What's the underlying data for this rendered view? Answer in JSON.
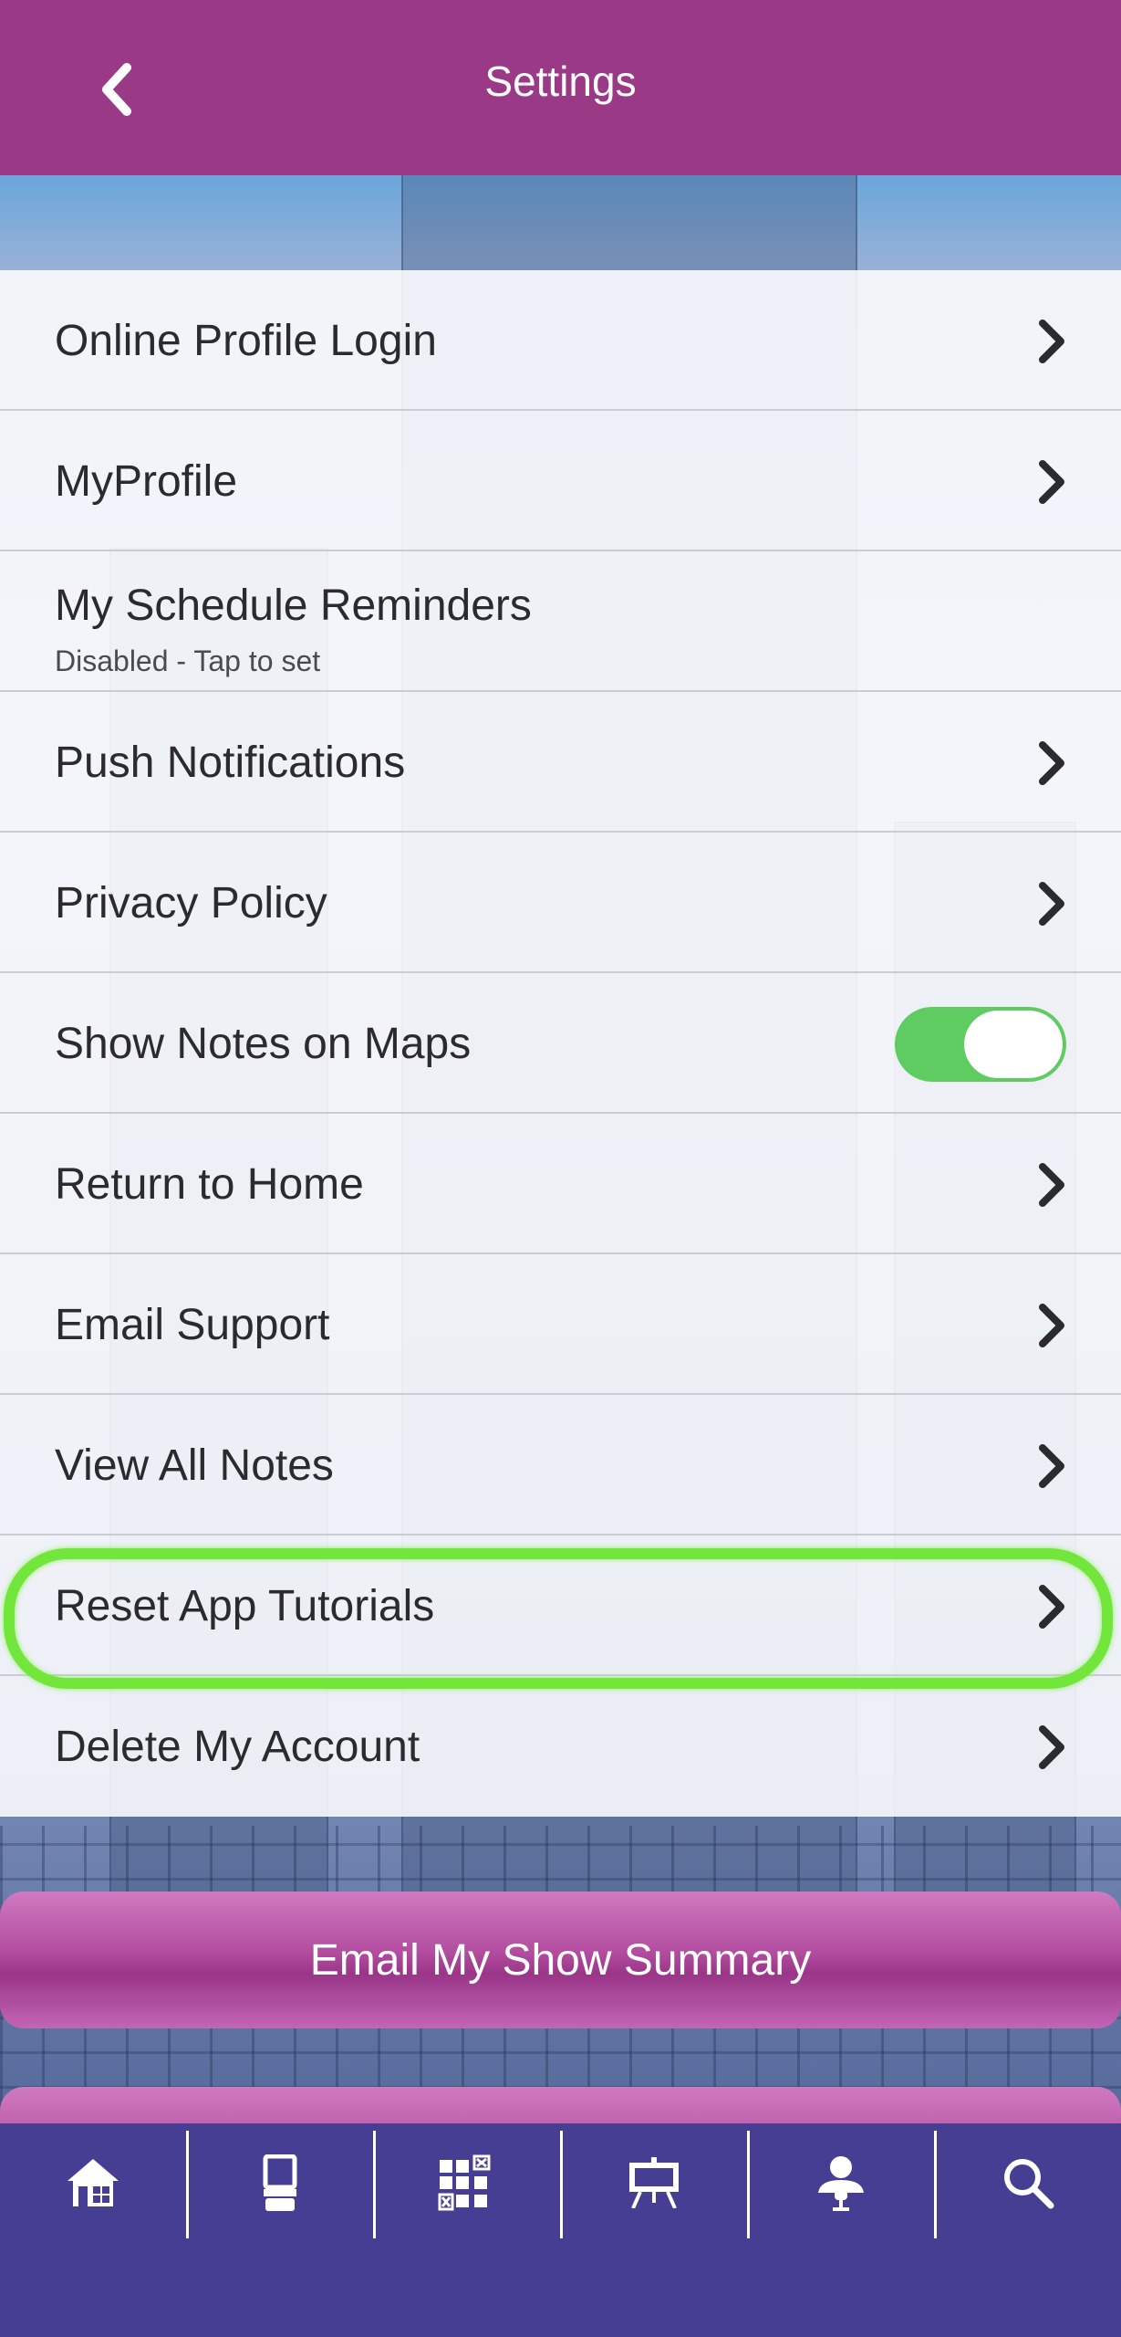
{
  "header": {
    "title": "Settings",
    "back_icon": "chevron-left-icon",
    "background": "#9a3a86"
  },
  "settings": {
    "items": [
      {
        "label": "Online Profile Login",
        "type": "link"
      },
      {
        "label": "MyProfile",
        "type": "link"
      },
      {
        "label": "My Schedule Reminders",
        "sub": "Disabled - Tap to set",
        "type": "info"
      },
      {
        "label": "Push Notifications",
        "type": "link"
      },
      {
        "label": "Privacy Policy",
        "type": "link"
      },
      {
        "label": "Show Notes on Maps",
        "type": "toggle",
        "toggle_on": true
      },
      {
        "label": "Return to Home",
        "type": "link"
      },
      {
        "label": "Email Support",
        "type": "link"
      },
      {
        "label": "View All Notes",
        "type": "link"
      },
      {
        "label": "Reset App Tutorials",
        "type": "link",
        "highlighted": true
      },
      {
        "label": "Delete My Account",
        "type": "link"
      }
    ],
    "toggle_color": "#5fcc61",
    "highlight_color": "#72e63a"
  },
  "actions": {
    "email_summary_label": "Email My Show Summary"
  },
  "nav": {
    "background": "#453e92",
    "items": [
      {
        "icon": "home-icon"
      },
      {
        "icon": "kiosk-icon"
      },
      {
        "icon": "floorplan-grid-icon"
      },
      {
        "icon": "presentation-board-icon"
      },
      {
        "icon": "speaker-icon"
      },
      {
        "icon": "search-icon"
      }
    ]
  }
}
